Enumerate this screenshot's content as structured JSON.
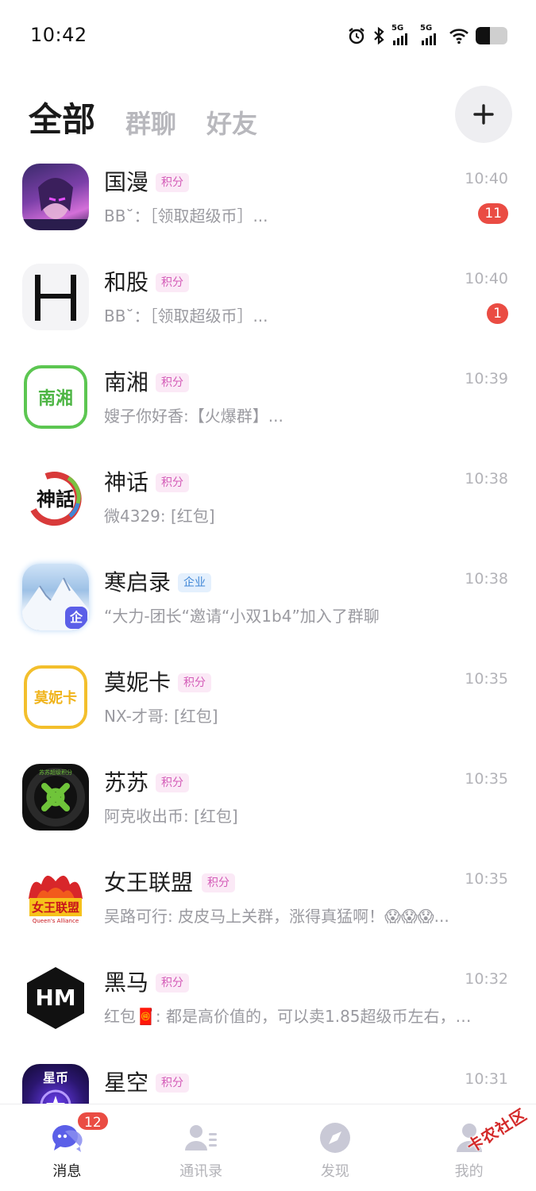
{
  "status_bar": {
    "time": "10:42",
    "net1": "5G",
    "net2": "5G",
    "battery_level": 0.45
  },
  "tabs": [
    {
      "label": "全部",
      "active": true
    },
    {
      "label": "群聊",
      "active": false
    },
    {
      "label": "好友",
      "active": false
    }
  ],
  "add_button_label": "+",
  "chats": [
    {
      "name": "国漫",
      "tag": "积分",
      "tag_type": "points",
      "time": "10:40",
      "preview": "BB˘：［领取超级币］...",
      "unread": "11"
    },
    {
      "name": "和股",
      "tag": "积分",
      "tag_type": "points",
      "time": "10:40",
      "preview": "BB˘：［领取超级币］...",
      "unread": "1"
    },
    {
      "name": "南湘",
      "tag": "积分",
      "tag_type": "points",
      "time": "10:39",
      "preview": "嫂子你好香:【火爆群】...",
      "unread": ""
    },
    {
      "name": "神话",
      "tag": "积分",
      "tag_type": "points",
      "time": "10:38",
      "preview": "微4329: [红包]",
      "unread": ""
    },
    {
      "name": "寒启录",
      "tag": "企业",
      "tag_type": "enterprise",
      "time": "10:38",
      "preview": "“大力-团长“邀请“小双1b4”加入了群聊",
      "unread": ""
    },
    {
      "name": "莫妮卡",
      "tag": "积分",
      "tag_type": "points",
      "time": "10:35",
      "preview": "NX-才哥: [红包]",
      "unread": ""
    },
    {
      "name": "苏苏",
      "tag": "积分",
      "tag_type": "points",
      "time": "10:35",
      "preview": "阿克收出币: [红包]",
      "unread": ""
    },
    {
      "name": "女王联盟",
      "tag": "积分",
      "tag_type": "points",
      "time": "10:35",
      "preview": "吴路可行: 皮皮马上关群，涨得真猛啊！😱😱😱...",
      "unread": ""
    },
    {
      "name": "黑马",
      "tag": "积分",
      "tag_type": "points",
      "time": "10:32",
      "preview": "红包🧧: 都是高价值的，可以卖1.85超级币左右，黑...",
      "unread": ""
    },
    {
      "name": "星空",
      "tag": "积分",
      "tag_type": "points",
      "time": "10:31",
      "preview": "",
      "unread": ""
    }
  ],
  "avatars": {
    "nanxiang_text": "南湘",
    "shenhua_text": "神話",
    "monika_text": "莫妮卡",
    "susu_ring_text": "苏苏超级积分",
    "nvwang_text": "女王联盟",
    "nvwang_sub": "Queen's Alliance",
    "heima_text": "HM",
    "xingkong_text": "星币",
    "hanqi_badge": "企"
  },
  "bottom_nav": [
    {
      "label": "消息",
      "active": true,
      "badge": "12"
    },
    {
      "label": "通讯录",
      "active": false,
      "badge": ""
    },
    {
      "label": "发现",
      "active": false,
      "badge": ""
    },
    {
      "label": "我的",
      "active": false,
      "badge": ""
    }
  ],
  "watermark": "卡农社区",
  "colors": {
    "accent": "#5b5fe8",
    "badge_red": "#ea4c43",
    "points_tag_text": "#d45cb8",
    "enterprise_tag_text": "#3f86d6"
  }
}
